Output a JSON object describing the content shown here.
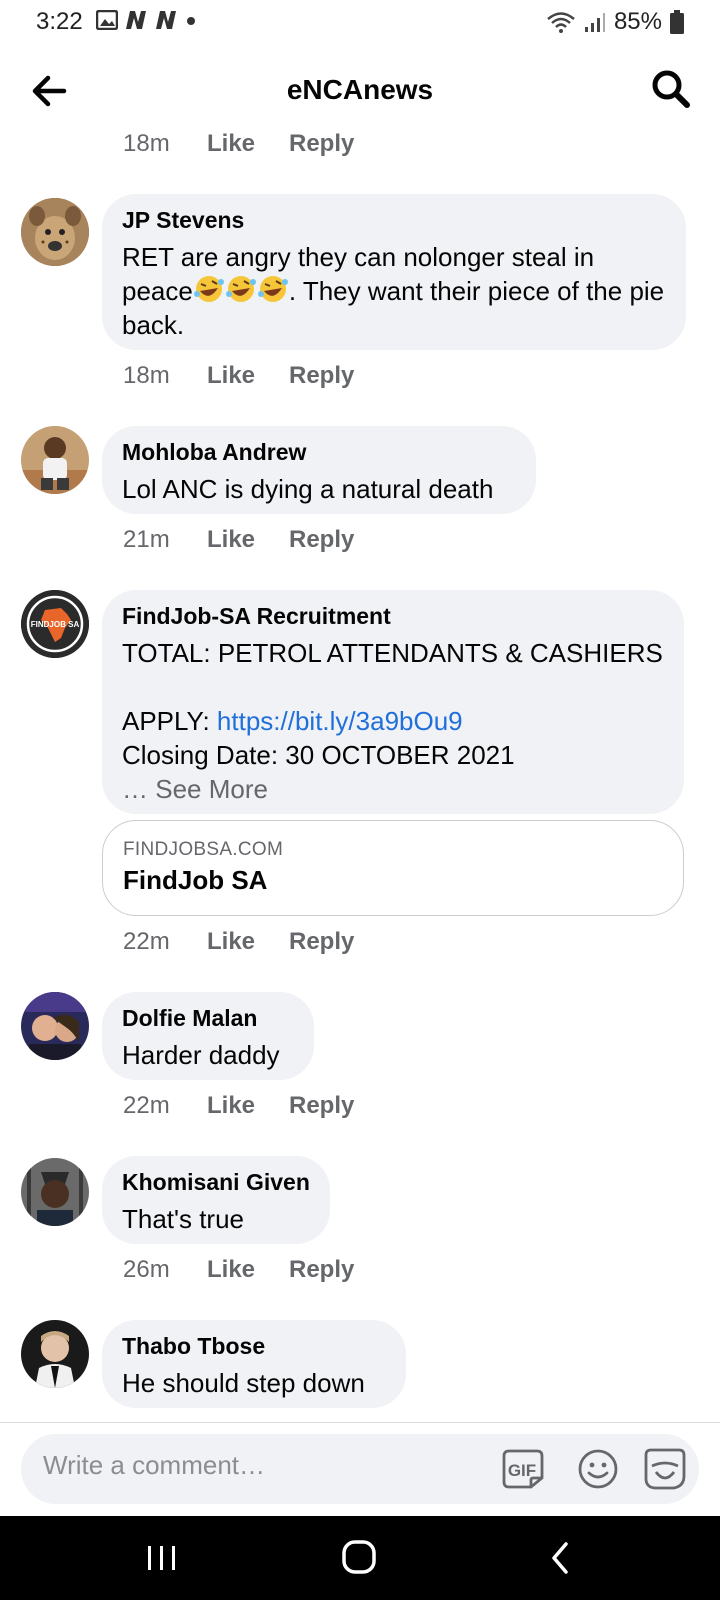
{
  "status_bar": {
    "time": "3:22",
    "battery": "85%",
    "icons": [
      "image-icon",
      "notification-n-icon",
      "notification-n-icon",
      "dot-icon",
      "wifi-icon",
      "signal-icon",
      "battery-icon"
    ]
  },
  "header": {
    "title": "eNCAnews",
    "back_icon": "arrow-left-icon",
    "search_icon": "search-icon"
  },
  "actions": {
    "like": "Like",
    "reply": "Reply"
  },
  "top_meta": {
    "time": "18m"
  },
  "comments": [
    {
      "author": "JP Stevens",
      "text_before": "RET are angry they can nolonger steal in peace",
      "emoji": "rofl-emoji x3",
      "text_after": ". They want their piece of the pie back.",
      "time": "18m"
    },
    {
      "author": "Mohloba Andrew",
      "text": "Lol ANC is dying a natural death",
      "time": "21m"
    },
    {
      "author": "FindJob-SA Recruitment",
      "line1": "TOTAL: PETROL ATTENDANTS & CASHIERS",
      "apply_label": "APPLY: ",
      "apply_link": "https://bit.ly/3a9bOu9",
      "closing": "Closing Date: 30 OCTOBER 2021",
      "see_more": "… See More",
      "link_domain": "FINDJOBSA.COM",
      "link_title": "FindJob SA",
      "avatar_text": "FINDJOB SA",
      "time": "22m"
    },
    {
      "author": "Dolfie Malan",
      "text": "Harder daddy",
      "time": "22m"
    },
    {
      "author": "Khomisani Given",
      "text": "That's true",
      "time": "26m"
    },
    {
      "author": "Thabo Tbose",
      "text": "He should step down"
    }
  ],
  "composer": {
    "placeholder": "Write a comment…",
    "gif_label": "GIF"
  },
  "colors": {
    "bubble": "#f0f2f5",
    "link": "#216fdb",
    "meta": "#65676b",
    "nav_bar": "#000000"
  }
}
